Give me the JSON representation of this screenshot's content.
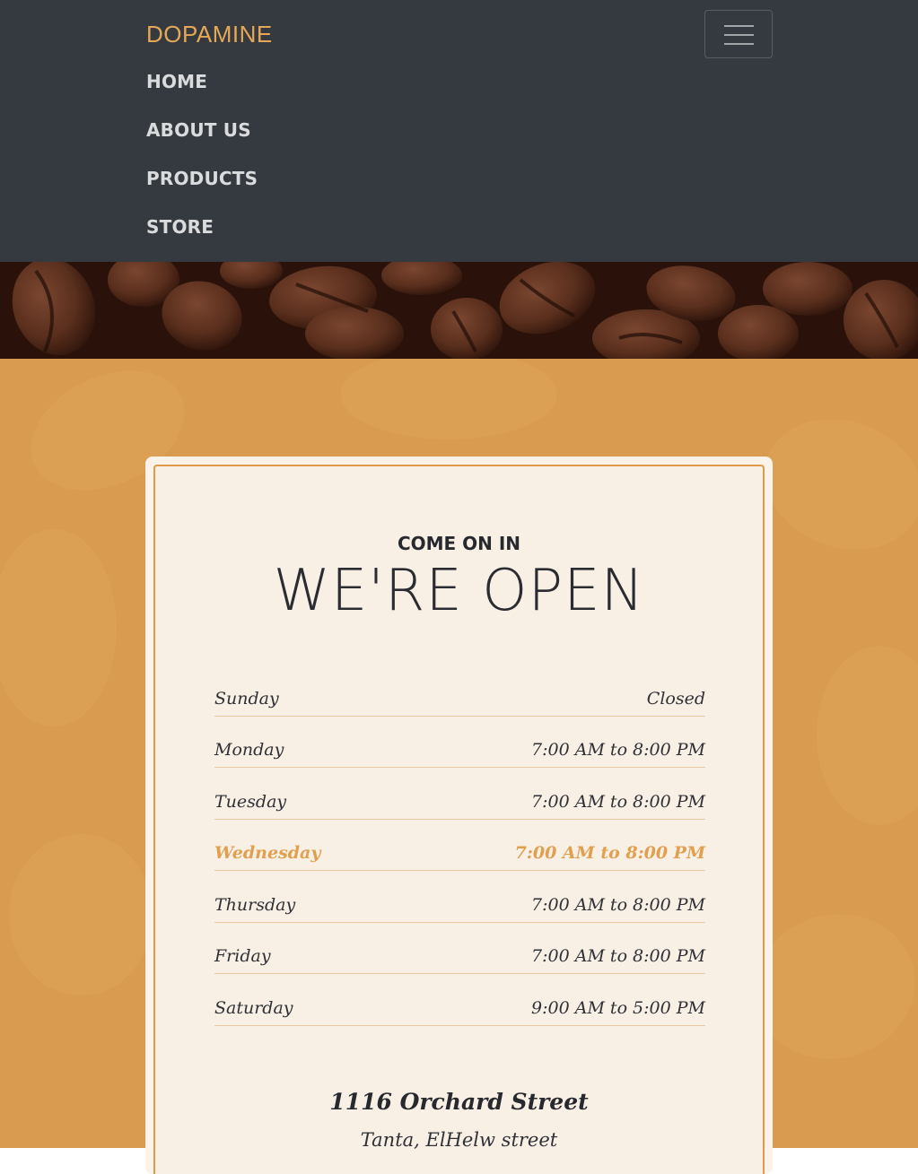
{
  "navbar": {
    "brand": "DOPAMINE",
    "toggle_icon": "hamburger-icon",
    "items": [
      {
        "label": "HOME"
      },
      {
        "label": "ABOUT US"
      },
      {
        "label": "PRODUCTS"
      },
      {
        "label": "STORE"
      }
    ]
  },
  "colors": {
    "navbar_bg": "#343a40",
    "accent": "#e6a756",
    "section_bg": "#d99b4f",
    "card_bg": "#f8efe5"
  },
  "hero": {
    "eyebrow": "COME ON IN",
    "title": "WE'RE OPEN"
  },
  "hours": [
    {
      "day": "Sunday",
      "time": "Closed",
      "today": false
    },
    {
      "day": "Monday",
      "time": "7:00 AM to 8:00 PM",
      "today": false
    },
    {
      "day": "Tuesday",
      "time": "7:00 AM to 8:00 PM",
      "today": false
    },
    {
      "day": "Wednesday",
      "time": "7:00 AM to 8:00 PM",
      "today": true
    },
    {
      "day": "Thursday",
      "time": "7:00 AM to 8:00 PM",
      "today": false
    },
    {
      "day": "Friday",
      "time": "7:00 AM to 8:00 PM",
      "today": false
    },
    {
      "day": "Saturday",
      "time": "9:00 AM to 5:00 PM",
      "today": false
    }
  ],
  "address": {
    "street": "1116 Orchard Street",
    "city": "Tanta, ElHelw street"
  }
}
